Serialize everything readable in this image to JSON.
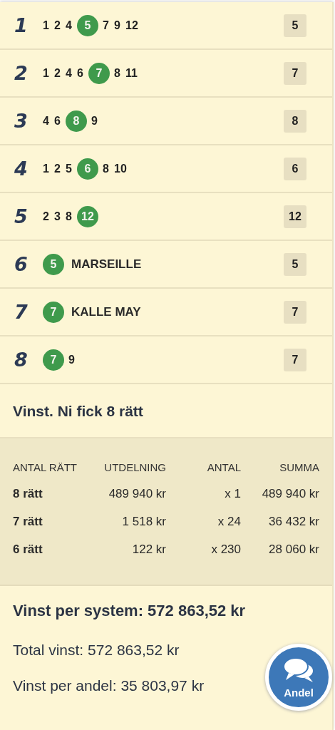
{
  "races": [
    {
      "number": "1",
      "picks": [
        {
          "label": "1",
          "selected": false
        },
        {
          "label": "2",
          "selected": false
        },
        {
          "label": "4",
          "selected": false
        },
        {
          "label": "5",
          "selected": true
        },
        {
          "label": "7",
          "selected": false
        },
        {
          "label": "9",
          "selected": false
        },
        {
          "label": "12",
          "selected": false
        }
      ],
      "result": "5"
    },
    {
      "number": "2",
      "picks": [
        {
          "label": "1",
          "selected": false
        },
        {
          "label": "2",
          "selected": false
        },
        {
          "label": "4",
          "selected": false
        },
        {
          "label": "6",
          "selected": false
        },
        {
          "label": "7",
          "selected": true
        },
        {
          "label": "8",
          "selected": false
        },
        {
          "label": "11",
          "selected": false
        }
      ],
      "result": "7"
    },
    {
      "number": "3",
      "picks": [
        {
          "label": "4",
          "selected": false
        },
        {
          "label": "6",
          "selected": false
        },
        {
          "label": "8",
          "selected": true
        },
        {
          "label": "9",
          "selected": false
        }
      ],
      "result": "8"
    },
    {
      "number": "4",
      "picks": [
        {
          "label": "1",
          "selected": false
        },
        {
          "label": "2",
          "selected": false
        },
        {
          "label": "5",
          "selected": false
        },
        {
          "label": "6",
          "selected": true
        },
        {
          "label": "8",
          "selected": false
        },
        {
          "label": "10",
          "selected": false
        }
      ],
      "result": "6"
    },
    {
      "number": "5",
      "picks": [
        {
          "label": "2",
          "selected": false
        },
        {
          "label": "3",
          "selected": false
        },
        {
          "label": "8",
          "selected": false
        },
        {
          "label": "12",
          "selected": true
        }
      ],
      "result": "12"
    },
    {
      "number": "6",
      "picks": [
        {
          "label": "5",
          "selected": true
        }
      ],
      "horse": "MARSEILLE",
      "result": "5"
    },
    {
      "number": "7",
      "picks": [
        {
          "label": "7",
          "selected": true
        }
      ],
      "horse": "KALLE MAY",
      "result": "7"
    },
    {
      "number": "8",
      "picks": [
        {
          "label": "7",
          "selected": true
        },
        {
          "label": "9",
          "selected": false
        }
      ],
      "result": "7"
    }
  ],
  "win_heading": "Vinst. Ni fick 8 rätt",
  "payout_table": {
    "columns": [
      "ANTAL RÄTT",
      "UTDELNING",
      "ANTAL",
      "SUMMA"
    ],
    "rows": [
      [
        "8 rätt",
        "489 940 kr",
        "x 1",
        "489 940 kr"
      ],
      [
        "7 rätt",
        "1 518 kr",
        "x 24",
        "36 432 kr"
      ],
      [
        "6 rätt",
        "122 kr",
        "x 230",
        "28 060 kr"
      ]
    ]
  },
  "summary": {
    "per_system": "Vinst per system: 572 863,52 kr",
    "total": "Total vinst: 572 863,52 kr",
    "per_share": "Vinst per andel: 35 803,97 kr"
  },
  "share_button": {
    "label": "Andel"
  }
}
